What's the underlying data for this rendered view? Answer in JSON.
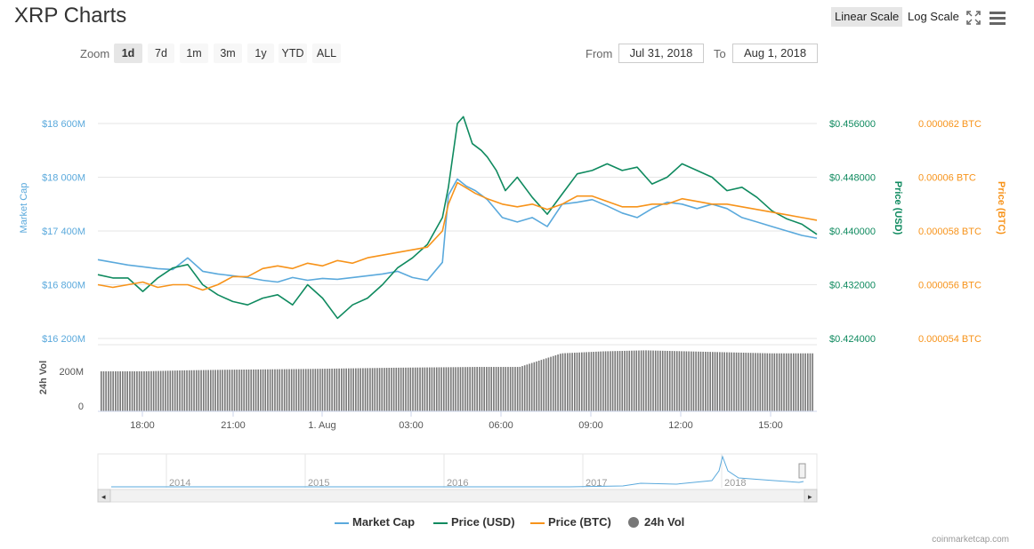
{
  "header": {
    "title": "XRP Charts",
    "linear_scale": "Linear Scale",
    "log_scale": "Log Scale",
    "fullscreen_icon": "fullscreen-icon",
    "menu_icon": "menu-icon"
  },
  "zoom": {
    "label": "Zoom",
    "buttons": [
      "1d",
      "7d",
      "1m",
      "3m",
      "1y",
      "YTD",
      "ALL"
    ],
    "active": "1d"
  },
  "range": {
    "from_label": "From",
    "from_value": "Jul 31, 2018",
    "to_label": "To",
    "to_value": "Aug 1, 2018"
  },
  "colors": {
    "market_cap": "#5aa9dc",
    "price_usd": "#0f8a5f",
    "price_btc": "#f7931a",
    "volume": "#777777",
    "grid": "#e6e6e6"
  },
  "chart_data": {
    "type": "line",
    "x_ticks": [
      "18:00",
      "21:00",
      "1. Aug",
      "03:00",
      "06:00",
      "09:00",
      "12:00",
      "15:00"
    ],
    "axes": {
      "market_cap": {
        "label": "Market Cap",
        "ticks": [
          "$16 200M",
          "$16 800M",
          "$17 400M",
          "$18 000M",
          "$18 600M"
        ],
        "range": [
          16200,
          18600
        ]
      },
      "price_usd": {
        "label": "Price (USD)",
        "ticks": [
          "$0.424000",
          "$0.432000",
          "$0.440000",
          "$0.448000",
          "$0.456000"
        ],
        "range": [
          0.424,
          0.456
        ]
      },
      "price_btc": {
        "label": "Price (BTC)",
        "ticks": [
          "0.000054 BTC",
          "0.000056 BTC",
          "0.000058 BTC",
          "0.00006 BTC",
          "0.000062 BTC"
        ],
        "range": [
          5.4e-05,
          6.2e-05
        ]
      },
      "volume": {
        "label": "24h Vol",
        "ticks": [
          "0",
          "200M"
        ]
      }
    },
    "series": [
      {
        "name": "Market Cap",
        "hours": [
          0,
          0.5,
          1,
          1.5,
          2,
          2.5,
          3,
          3.5,
          4,
          4.5,
          5,
          5.5,
          6,
          6.5,
          7,
          7.5,
          8,
          8.5,
          9,
          9.5,
          10,
          10.5,
          11,
          11.5,
          11.7,
          12,
          12.3,
          12.6,
          13,
          13.5,
          14,
          14.5,
          15,
          15.5,
          16,
          16.5,
          17,
          17.5,
          18,
          18.5,
          19,
          19.5,
          20,
          20.5,
          21,
          21.5,
          22,
          22.5,
          23,
          23.5,
          24
        ],
        "values": [
          17080,
          17050,
          17020,
          17000,
          16980,
          16970,
          17100,
          16950,
          16920,
          16900,
          16880,
          16850,
          16830,
          16880,
          16850,
          16870,
          16860,
          16880,
          16900,
          16920,
          16950,
          16880,
          16850,
          17050,
          17800,
          17980,
          17900,
          17850,
          17750,
          17550,
          17500,
          17550,
          17450,
          17700,
          17720,
          17750,
          17680,
          17600,
          17550,
          17650,
          17720,
          17700,
          17650,
          17700,
          17650,
          17550,
          17500,
          17450,
          17400,
          17350,
          17320
        ]
      },
      {
        "name": "Price (USD)",
        "hours": [
          0,
          0.5,
          1,
          1.5,
          2,
          2.5,
          3,
          3.5,
          4,
          4.5,
          5,
          5.5,
          6,
          6.5,
          7,
          7.5,
          8,
          8.5,
          9,
          9.5,
          10,
          10.5,
          11,
          11.5,
          11.7,
          12,
          12.2,
          12.5,
          12.8,
          13,
          13.3,
          13.6,
          14,
          14.5,
          15,
          15.5,
          16,
          16.5,
          17,
          17.5,
          18,
          18.5,
          19,
          19.5,
          20,
          20.5,
          21,
          21.5,
          22,
          22.5,
          23,
          23.5,
          24
        ],
        "values": [
          0.4335,
          0.433,
          0.433,
          0.431,
          0.433,
          0.4345,
          0.435,
          0.432,
          0.4305,
          0.4295,
          0.429,
          0.43,
          0.4305,
          0.429,
          0.432,
          0.43,
          0.427,
          0.429,
          0.43,
          0.432,
          0.4345,
          0.436,
          0.438,
          0.442,
          0.4465,
          0.456,
          0.457,
          0.453,
          0.452,
          0.451,
          0.449,
          0.446,
          0.448,
          0.445,
          0.4425,
          0.4455,
          0.4485,
          0.449,
          0.45,
          0.449,
          0.4495,
          0.447,
          0.448,
          0.45,
          0.449,
          0.448,
          0.446,
          0.4465,
          0.445,
          0.443,
          0.4418,
          0.441,
          0.4395
        ]
      },
      {
        "name": "Price (BTC)",
        "hours": [
          0,
          0.5,
          1,
          1.5,
          2,
          2.5,
          3,
          3.5,
          4,
          4.5,
          5,
          5.5,
          6,
          6.5,
          7,
          7.5,
          8,
          8.5,
          9,
          9.5,
          10,
          10.5,
          11,
          11.5,
          11.7,
          12,
          12.3,
          12.6,
          13,
          13.5,
          14,
          14.5,
          15,
          15.5,
          16,
          16.5,
          17,
          17.5,
          18,
          18.5,
          19,
          19.5,
          20,
          20.5,
          21,
          21.5,
          22,
          22.5,
          23,
          23.5,
          24
        ],
        "values": [
          5.6e-05,
          5.59e-05,
          5.6e-05,
          5.61e-05,
          5.59e-05,
          5.6e-05,
          5.6e-05,
          5.58e-05,
          5.6e-05,
          5.63e-05,
          5.63e-05,
          5.66e-05,
          5.67e-05,
          5.66e-05,
          5.68e-05,
          5.67e-05,
          5.69e-05,
          5.68e-05,
          5.7e-05,
          5.71e-05,
          5.72e-05,
          5.73e-05,
          5.74e-05,
          5.8e-05,
          5.9e-05,
          5.98e-05,
          5.96e-05,
          5.94e-05,
          5.92e-05,
          5.9e-05,
          5.89e-05,
          5.9e-05,
          5.88e-05,
          5.9e-05,
          5.93e-05,
          5.93e-05,
          5.91e-05,
          5.89e-05,
          5.89e-05,
          5.9e-05,
          5.9e-05,
          5.92e-05,
          5.91e-05,
          5.9e-05,
          5.9e-05,
          5.89e-05,
          5.88e-05,
          5.87e-05,
          5.86e-05,
          5.85e-05,
          5.84e-05
        ]
      },
      {
        "name": "24h Vol",
        "values_m": [
          200,
          200,
          205,
          208,
          210,
          212,
          215,
          218,
          220,
          222,
          222,
          290,
          300,
          305,
          300,
          295,
          290,
          290
        ]
      }
    ],
    "navigator": {
      "years": [
        "2014",
        "2015",
        "2016",
        "2017",
        "2018"
      ]
    },
    "legend": [
      "Market Cap",
      "Price (USD)",
      "Price (BTC)",
      "24h Vol"
    ],
    "legend_position": "bottom"
  },
  "credit": "coinmarketcap.com"
}
